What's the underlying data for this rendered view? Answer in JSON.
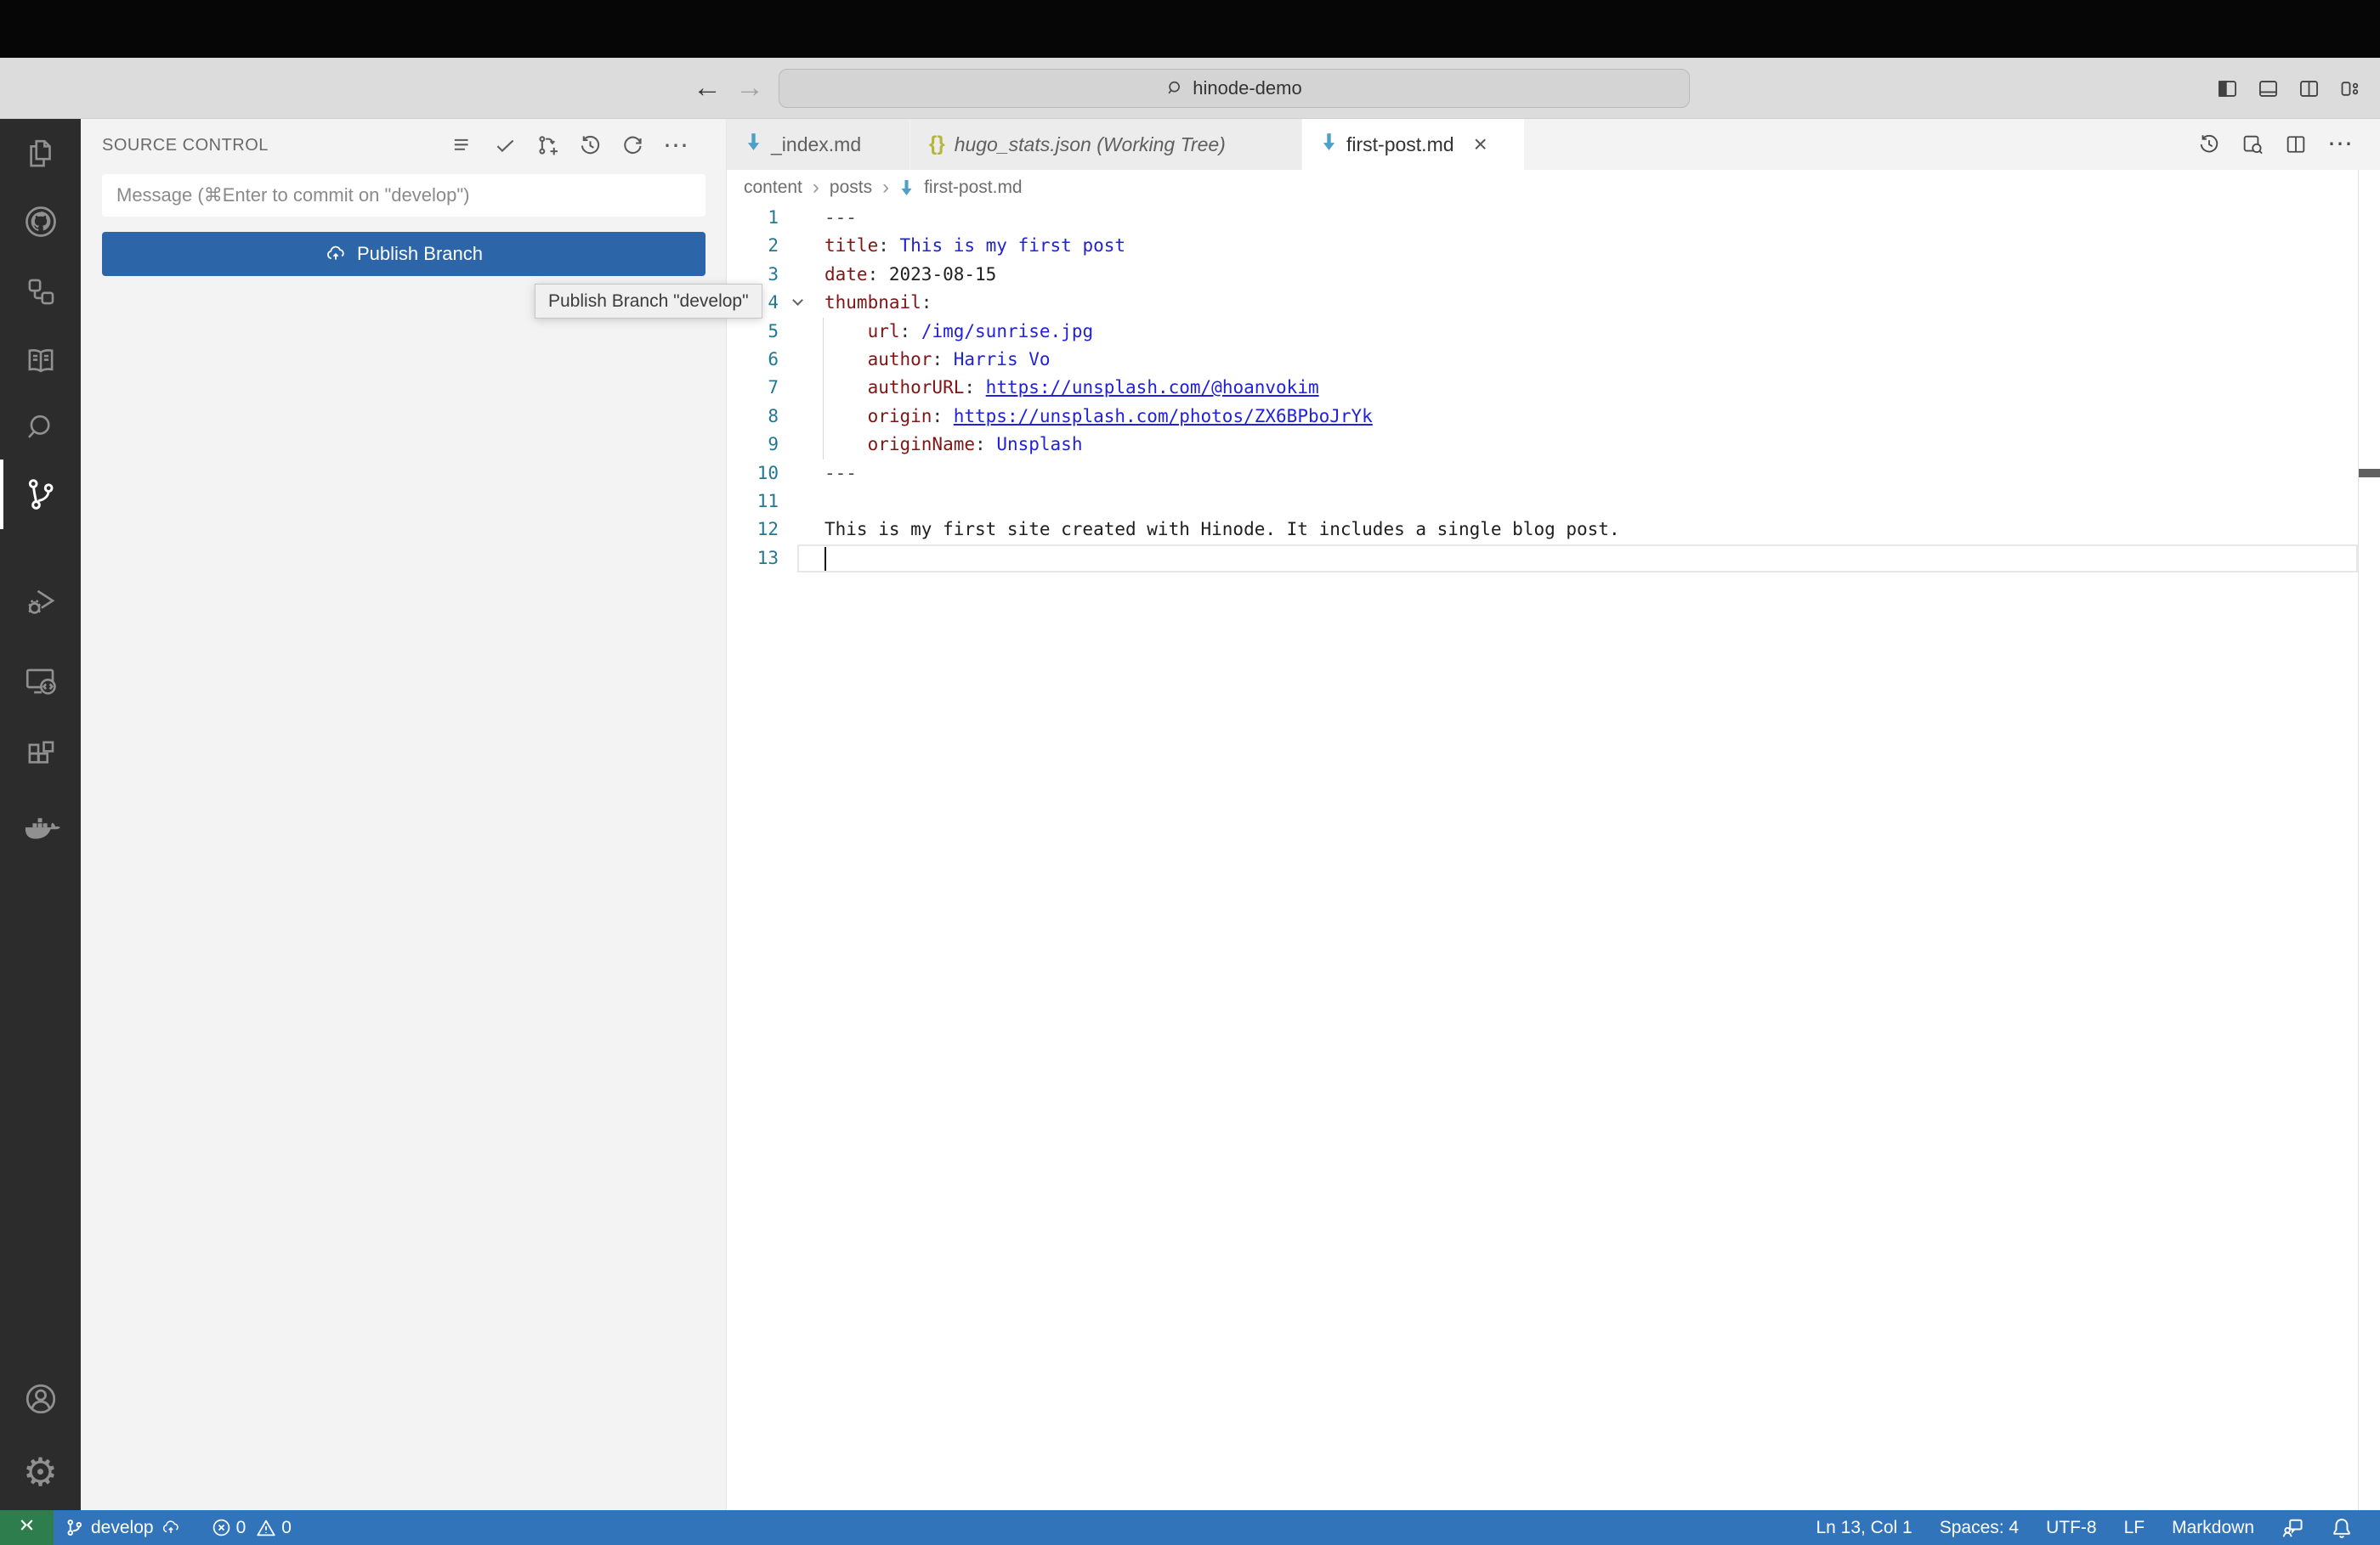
{
  "titlebar": {
    "search_text": "hinode-demo"
  },
  "activity_bar": {
    "items": [
      "explorer",
      "github",
      "hierarchy",
      "docs",
      "search",
      "source-control",
      "run-debug",
      "remote-explorer",
      "extensions",
      "docker",
      "account",
      "settings"
    ],
    "active": "source-control"
  },
  "sidebar": {
    "title": "SOURCE CONTROL",
    "message_placeholder": "Message (⌘Enter to commit on \"develop\")",
    "publish_button": "Publish Branch",
    "tooltip": "Publish Branch \"develop\""
  },
  "tabs": [
    {
      "label": "_index.md",
      "icon": "markdown"
    },
    {
      "label": "hugo_stats.json (Working Tree)",
      "icon": "json"
    },
    {
      "label": "first-post.md",
      "icon": "markdown"
    }
  ],
  "breadcrumb": {
    "items": [
      "content",
      "posts"
    ],
    "file": "first-post.md"
  },
  "editor": {
    "lines": [
      {
        "tokens": [
          [
            "m",
            "---"
          ]
        ]
      },
      {
        "tokens": [
          [
            "k",
            "title"
          ],
          [
            "p",
            ": "
          ],
          [
            "s",
            "This is my first post"
          ]
        ]
      },
      {
        "tokens": [
          [
            "k",
            "date"
          ],
          [
            "p",
            ": "
          ],
          [
            "t",
            "2023-08-15"
          ]
        ]
      },
      {
        "fold": true,
        "tokens": [
          [
            "k",
            "thumbnail"
          ],
          [
            "p",
            ":"
          ]
        ]
      },
      {
        "guide": true,
        "tokens": [
          [
            "t",
            "    "
          ],
          [
            "k",
            "url"
          ],
          [
            "p",
            ": "
          ],
          [
            "s",
            "/img/sunrise.jpg"
          ]
        ]
      },
      {
        "guide": true,
        "tokens": [
          [
            "t",
            "    "
          ],
          [
            "k",
            "author"
          ],
          [
            "p",
            ": "
          ],
          [
            "s",
            "Harris Vo"
          ]
        ]
      },
      {
        "guide": true,
        "tokens": [
          [
            "t",
            "    "
          ],
          [
            "k",
            "authorURL"
          ],
          [
            "p",
            ": "
          ],
          [
            "l",
            "https://unsplash.com/@hoanvokim"
          ]
        ]
      },
      {
        "guide": true,
        "tokens": [
          [
            "t",
            "    "
          ],
          [
            "k",
            "origin"
          ],
          [
            "p",
            ": "
          ],
          [
            "l",
            "https://unsplash.com/photos/ZX6BPboJrYk"
          ]
        ]
      },
      {
        "guide": true,
        "tokens": [
          [
            "t",
            "    "
          ],
          [
            "k",
            "originName"
          ],
          [
            "p",
            ": "
          ],
          [
            "s",
            "Unsplash"
          ]
        ]
      },
      {
        "tokens": [
          [
            "m",
            "---"
          ]
        ]
      },
      {
        "tokens": []
      },
      {
        "tokens": [
          [
            "t",
            "This is my first site created with Hinode. It includes a single blog post."
          ]
        ]
      },
      {
        "current": true,
        "cursor": true,
        "tokens": []
      }
    ]
  },
  "status_bar": {
    "branch": "develop",
    "errors": "0",
    "warnings": "0",
    "line_col": "Ln 13, Col 1",
    "spaces": "Spaces: 4",
    "encoding": "UTF-8",
    "eol": "LF",
    "language": "Markdown"
  },
  "colors": {
    "accent-button": "#2d66a8",
    "statusbar": "#3274b9",
    "remote": "#2e7d4d",
    "md-icon": "#4f9fc9",
    "json-icon": "#b5b53d",
    "key": "#801515",
    "value": "#2121db",
    "plain": "#202020",
    "meta": "#4b4b4b",
    "line-number": "#237893"
  }
}
